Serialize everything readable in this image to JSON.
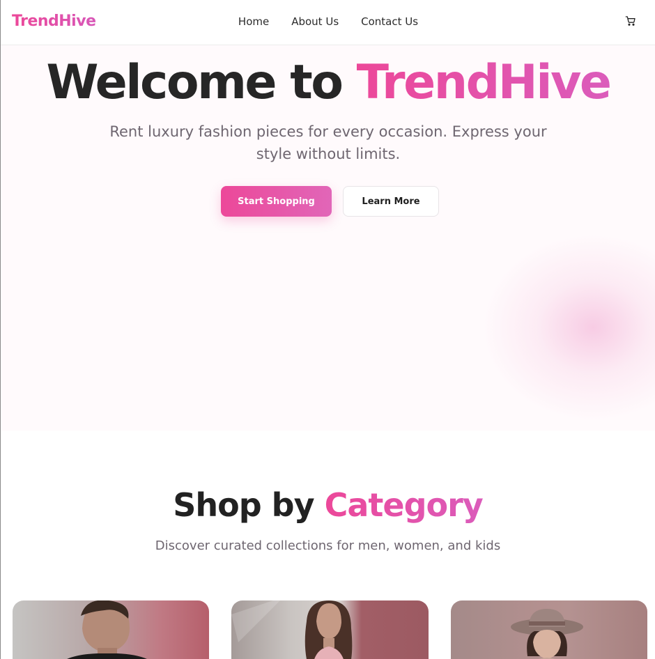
{
  "brand": {
    "name": "TrendHive",
    "accent_color": "#ec4899"
  },
  "nav": {
    "items": [
      {
        "label": "Home"
      },
      {
        "label": "About Us"
      },
      {
        "label": "Contact Us"
      }
    ],
    "cart_icon": "shopping-cart-icon"
  },
  "hero": {
    "title_prefix": "Welcome to",
    "title_accent": "TrendHive",
    "subtitle": "Rent luxury fashion pieces for every occasion. Express your style without limits.",
    "primary_button": "Start Shopping",
    "secondary_button": "Learn More"
  },
  "categories": {
    "title_prefix": "Shop by",
    "title_accent": "Category",
    "subtitle": "Discover curated collections for men, women, and kids"
  }
}
